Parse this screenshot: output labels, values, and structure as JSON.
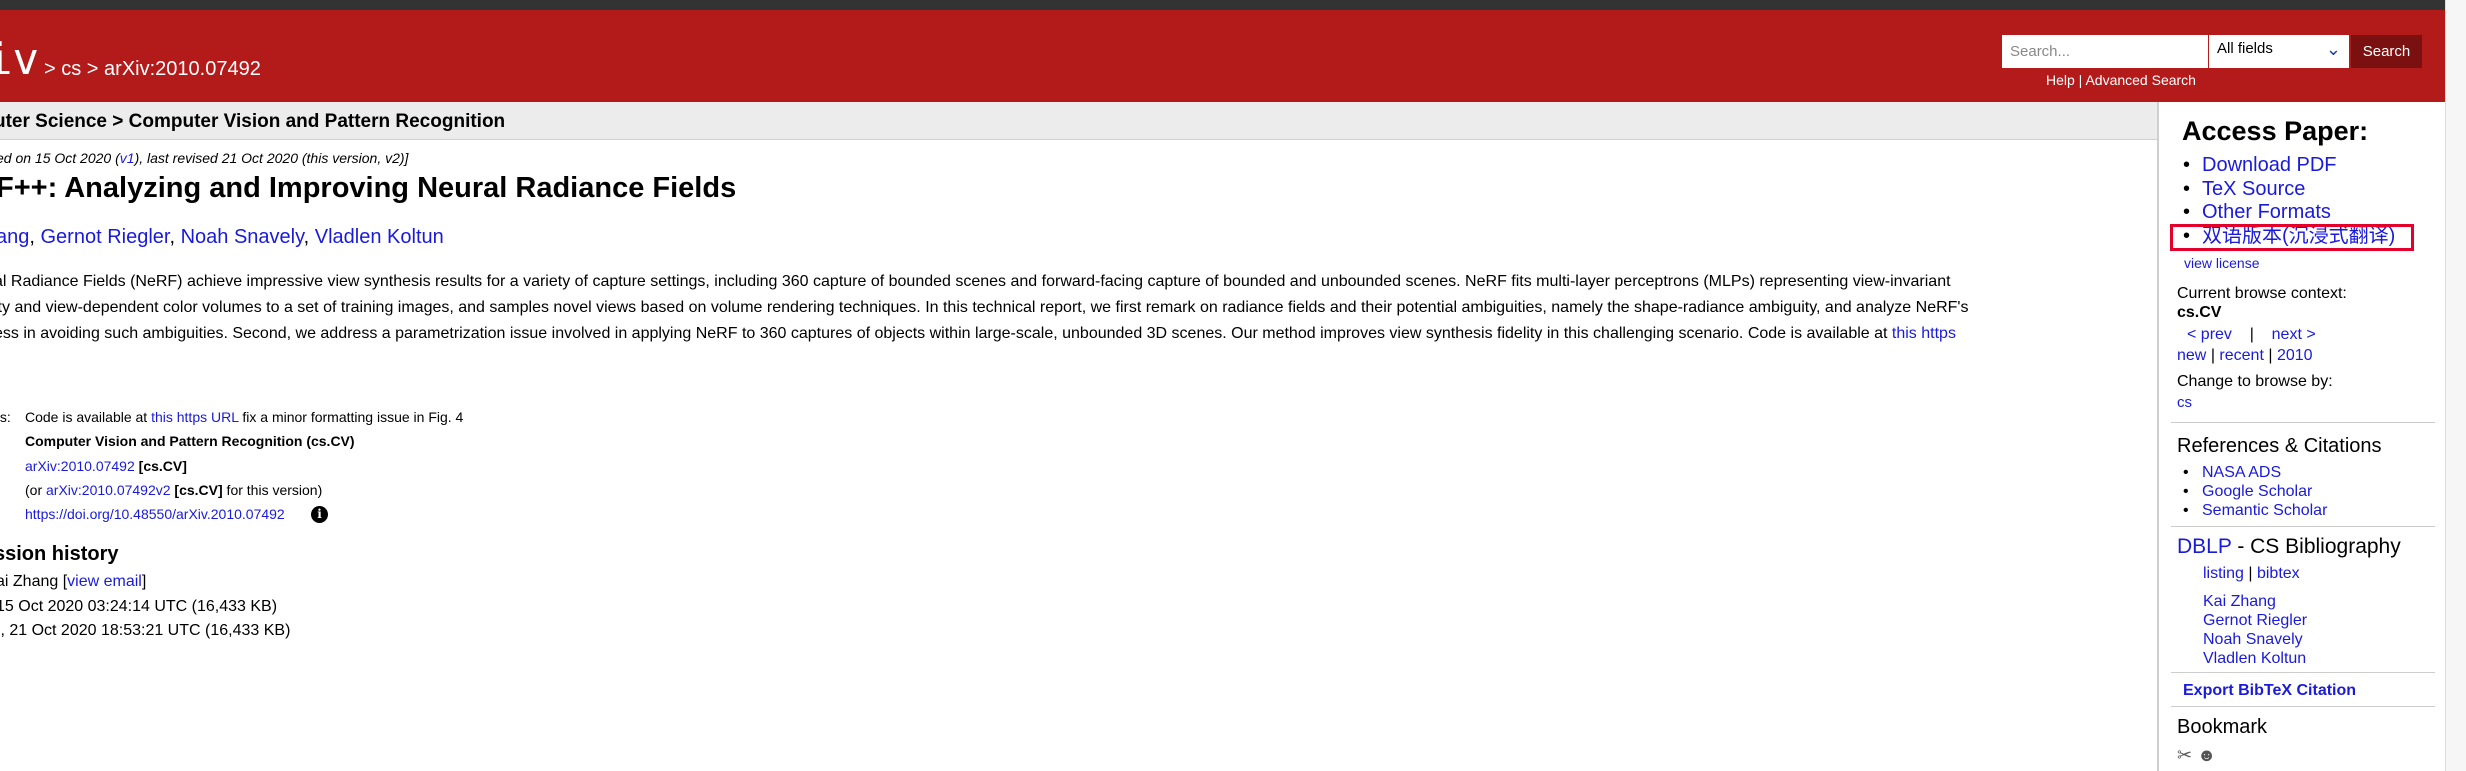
{
  "header": {
    "logo": "iv",
    "breadcrumb": "> cs > arXiv:2010.07492",
    "search_placeholder": "Search...",
    "field_select": "All fields",
    "search_button": "Search",
    "help": "Help",
    "sep": " | ",
    "advanced": "Advanced Search"
  },
  "subheader": "uter Science > Computer Vision and Pattern Recognition",
  "main": {
    "dateline_a": "ed on 15 Oct 2020 (",
    "dateline_v1": "v1",
    "dateline_b": "), last revised 21 Oct 2020 (this version, v2)]",
    "title": "F++: Analyzing and Improving Neural Radiance Fields",
    "authors": [
      "ang",
      "Gernot Riegler",
      "Noah Snavely",
      "Vladlen Koltun"
    ],
    "author_sep": ", ",
    "abstract": [
      "al Radiance Fields (NeRF) achieve impressive view synthesis results for a variety of capture settings, including 360 capture of bounded scenes and forward-facing capture of bounded and unbounded scenes. NeRF fits multi-layer perceptrons (MLPs) representing view-invariant",
      "ity and view-dependent color volumes to a set of training images, and samples novel views based on volume rendering techniques. In this technical report, we first remark on radiance fields and their potential ambiguities, namely the shape-radiance ambiguity, and analyze NeRF's",
      "ess in avoiding such ambiguities. Second, we address a parametrization issue involved in applying NeRF to 360 captures of objects within large-scale, unbounded 3D scenes. Our method improves view synthesis fidelity in this challenging scenario. Code is available at "
    ],
    "abstract_link": "this https",
    "comments_label": "ts:",
    "comments_a": "Code is available at ",
    "comments_link": "this https URL",
    "comments_b": " fix a minor formatting issue in Fig. 4",
    "subjects": "Computer Vision and Pattern Recognition (cs.CV)",
    "cite_link": "arXiv:2010.07492",
    "cite_tag": " [cs.CV]",
    "cite2_a": "(or ",
    "cite2_link": "arXiv:2010.07492v2",
    "cite2_tag": " [cs.CV]",
    "cite2_b": " for this version)",
    "doi": "https://doi.org/10.48550/arXiv.2010.07492",
    "info_icon": "i",
    "history_title": "ssion history",
    "from_a": "ai Zhang [",
    "from_link": "view email",
    "from_b": "]",
    "v1_line": " 15 Oct 2020 03:24:14 UTC (16,433 KB)",
    "v2_line": "], 21 Oct 2020 18:53:21 UTC (16,433 KB)"
  },
  "sidebar": {
    "access_title": "Access Paper:",
    "access_items": [
      "Download PDF",
      "TeX Source",
      "Other Formats",
      "双语版本(沉浸式翻译)"
    ],
    "view_license": "view license",
    "browse_label": "Current browse context:",
    "browse_cat": "cs.CV",
    "prev": "< prev",
    "bar": "|",
    "next": "next >",
    "new": "new",
    "recent": "recent",
    "year": "2010",
    "change_label": "Change to browse by:",
    "cs": "cs",
    "refs_title": "References & Citations",
    "refs": [
      "NASA ADS",
      "Google Scholar",
      "Semantic Scholar"
    ],
    "dblp": "DBLP",
    "dblp_rest": " - CS Bibliography",
    "listing": "listing",
    "bibtex": "bibtex",
    "dblp_authors": [
      "Kai Zhang",
      "Gernot Riegler",
      "Noah Snavely",
      "Vladlen Koltun"
    ],
    "export": "Export BibTeX Citation",
    "bookmark_title": "Bookmark",
    "bookmark_icons": [
      "science-wise-icon",
      "reddit-icon"
    ]
  },
  "colors": {
    "header_red": "#b31b1b",
    "link_blue": "#1a1adb",
    "highlight_red": "#e4002b"
  }
}
